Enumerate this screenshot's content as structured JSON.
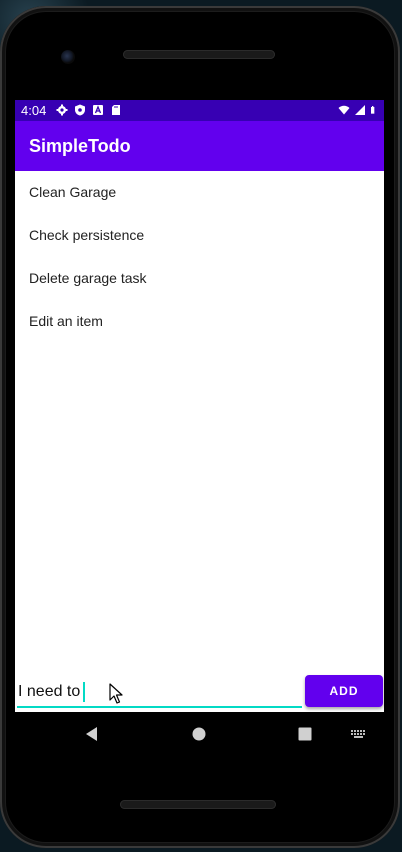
{
  "status_bar": {
    "time": "4:04",
    "left_icons": [
      "settings-icon",
      "shield-icon",
      "a-icon",
      "sd-card-icon"
    ],
    "right_icons": [
      "wifi-icon",
      "signal-icon",
      "battery-icon"
    ]
  },
  "app_bar": {
    "title": "SimpleTodo",
    "color": "#6200ee",
    "status_color": "#3700b3"
  },
  "todo_list": {
    "items": [
      "Clean Garage",
      "Check persistence",
      "Delete garage task",
      "Edit an item"
    ]
  },
  "input": {
    "value": "I need to ",
    "accent_color": "#03dac5"
  },
  "add_button": {
    "label": "ADD"
  },
  "nav_bar": {
    "icons": [
      "back-icon",
      "home-icon",
      "recents-icon",
      "keyboard-icon"
    ]
  }
}
